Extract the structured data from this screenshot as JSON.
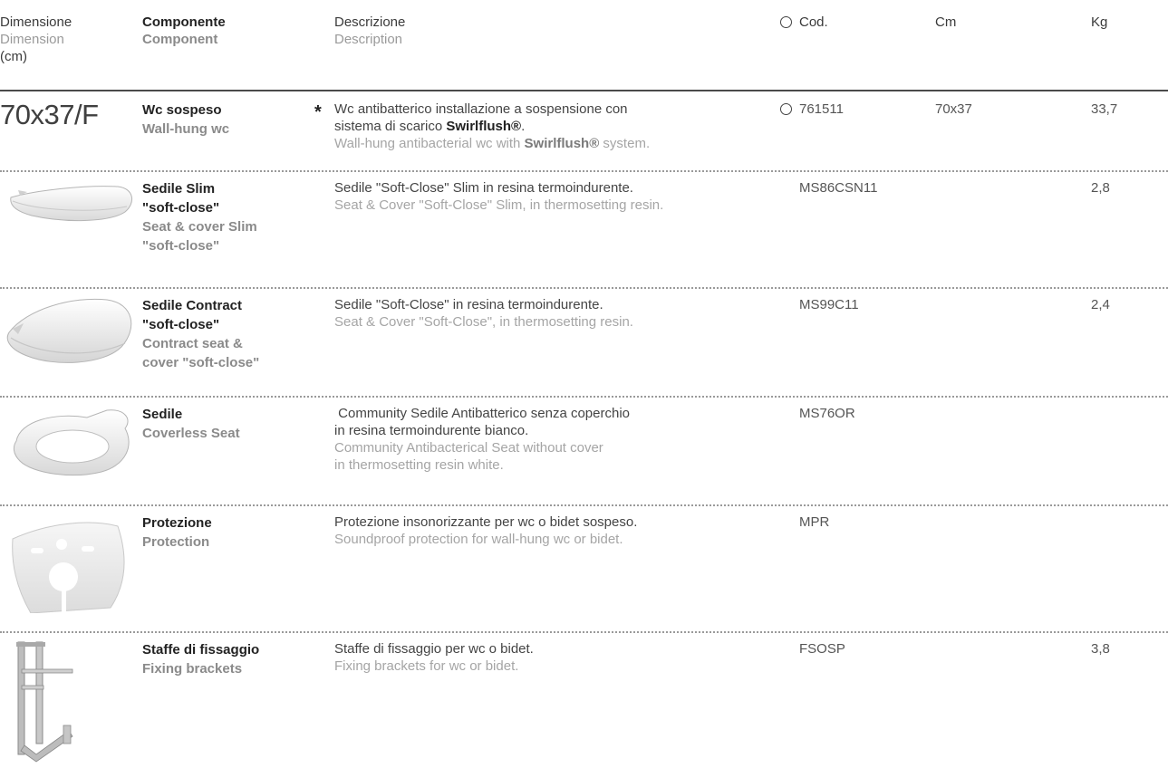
{
  "header": {
    "dimension_it": "Dimensione",
    "dimension_en": "Dimension",
    "dimension_unit": "(cm)",
    "component_it": "Componente",
    "component_en": "Component",
    "description_it": "Descrizione",
    "description_en": "Description",
    "code": "Cod.",
    "cm": "Cm",
    "kg": "Kg"
  },
  "dimension": "70x37/F",
  "rows": [
    {
      "name_it": "Wc sospeso",
      "name_en": "Wall-hung wc",
      "marker": "*",
      "desc_it_1": "Wc antibatterico installazione a sospensione con",
      "desc_it_2a": "sistema di scarico ",
      "desc_it_2b": "Swirlflush®",
      "desc_it_2c": ".",
      "desc_en_a": "Wall-hung antibacterial wc with ",
      "desc_en_b": "Swirlflush®",
      "desc_en_c": " system.",
      "code": "761511",
      "cm": "70x37",
      "kg": "33,7"
    },
    {
      "name_it_1": "Sedile Slim",
      "name_it_2": "\"soft-close\"",
      "name_en_1": "Seat & cover Slim",
      "name_en_2": "\"soft-close\"",
      "desc_it": "Sedile \"Soft-Close\" Slim in resina termoindurente.",
      "desc_en": "Seat & Cover \"Soft-Close\" Slim, in thermosetting resin.",
      "code": "MS86CSN11",
      "kg": "2,8",
      "icon": "slim-seat-icon"
    },
    {
      "name_it_1": "Sedile Contract",
      "name_it_2": "\"soft-close\"",
      "name_en_1": "Contract seat &",
      "name_en_2": "cover \"soft-close\"",
      "desc_it": "Sedile \"Soft-Close\" in resina termoindurente.",
      "desc_en": "Seat & Cover \"Soft-Close\", in thermosetting resin.",
      "code": "MS99C11",
      "kg": "2,4",
      "icon": "contract-seat-icon"
    },
    {
      "name_it": "Sedile",
      "name_en": "Coverless Seat",
      "desc_it_1": " Community Sedile Antibatterico senza coperchio",
      "desc_it_2": "in resina termoindurente bianco.",
      "desc_en_1": "Community Antibacterical Seat without cover",
      "desc_en_2": "in thermosetting resin white.",
      "code": "MS76OR",
      "icon": "coverless-seat-icon"
    },
    {
      "name_it": "Protezione",
      "name_en": "Protection",
      "desc_it": "Protezione insonorizzante per wc o bidet sospeso.",
      "desc_en": "Soundproof protection for wall-hung wc or bidet.",
      "code": "MPR",
      "icon": "protection-pad-icon"
    },
    {
      "name_it": "Staffe di fissaggio",
      "name_en": "Fixing brackets",
      "desc_it": "Staffe di fissaggio per wc o bidet.",
      "desc_en": "Fixing brackets for wc or bidet.",
      "code": "FSOSP",
      "kg": "3,8",
      "icon": "fixing-bracket-icon"
    }
  ]
}
